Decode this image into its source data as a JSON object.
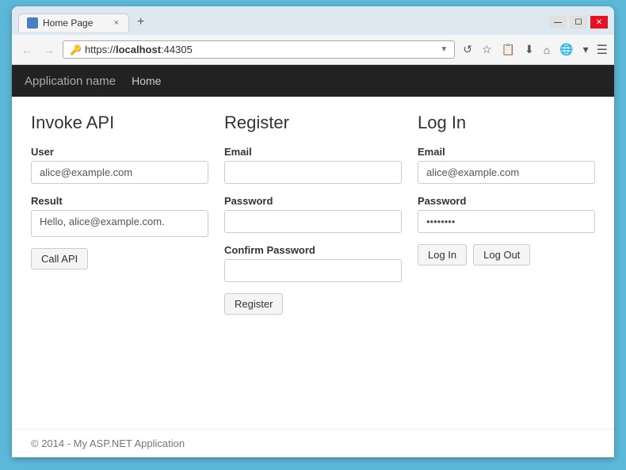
{
  "browser": {
    "tab_icon": "page-icon",
    "tab_title": "Home Page",
    "tab_close": "×",
    "new_tab": "+",
    "minimize": "—",
    "restore": "☐",
    "close": "✕",
    "back_btn": "←",
    "forward_btn": "→",
    "url_protocol": "https://",
    "url_bold": "localhost",
    "url_rest": ":44305",
    "reload": "↺",
    "dropdown": "▼"
  },
  "navbar": {
    "brand": "Application name",
    "links": [
      "Home"
    ]
  },
  "sections": {
    "invoke": {
      "title": "Invoke API",
      "user_label": "User",
      "user_placeholder": "alice@example.com",
      "user_value": "alice@example.com",
      "result_label": "Result",
      "result_value": "Hello, alice@example.com.",
      "call_btn": "Call API"
    },
    "register": {
      "title": "Register",
      "email_label": "Email",
      "email_placeholder": "",
      "password_label": "Password",
      "password_placeholder": "",
      "confirm_label": "Confirm Password",
      "confirm_placeholder": "",
      "register_btn": "Register"
    },
    "login": {
      "title": "Log In",
      "email_label": "Email",
      "email_value": "alice@example.com",
      "password_label": "Password",
      "password_value": "••••••••",
      "login_btn": "Log In",
      "logout_btn": "Log Out"
    }
  },
  "footer": {
    "text": "© 2014 - My ASP.NET Application"
  }
}
